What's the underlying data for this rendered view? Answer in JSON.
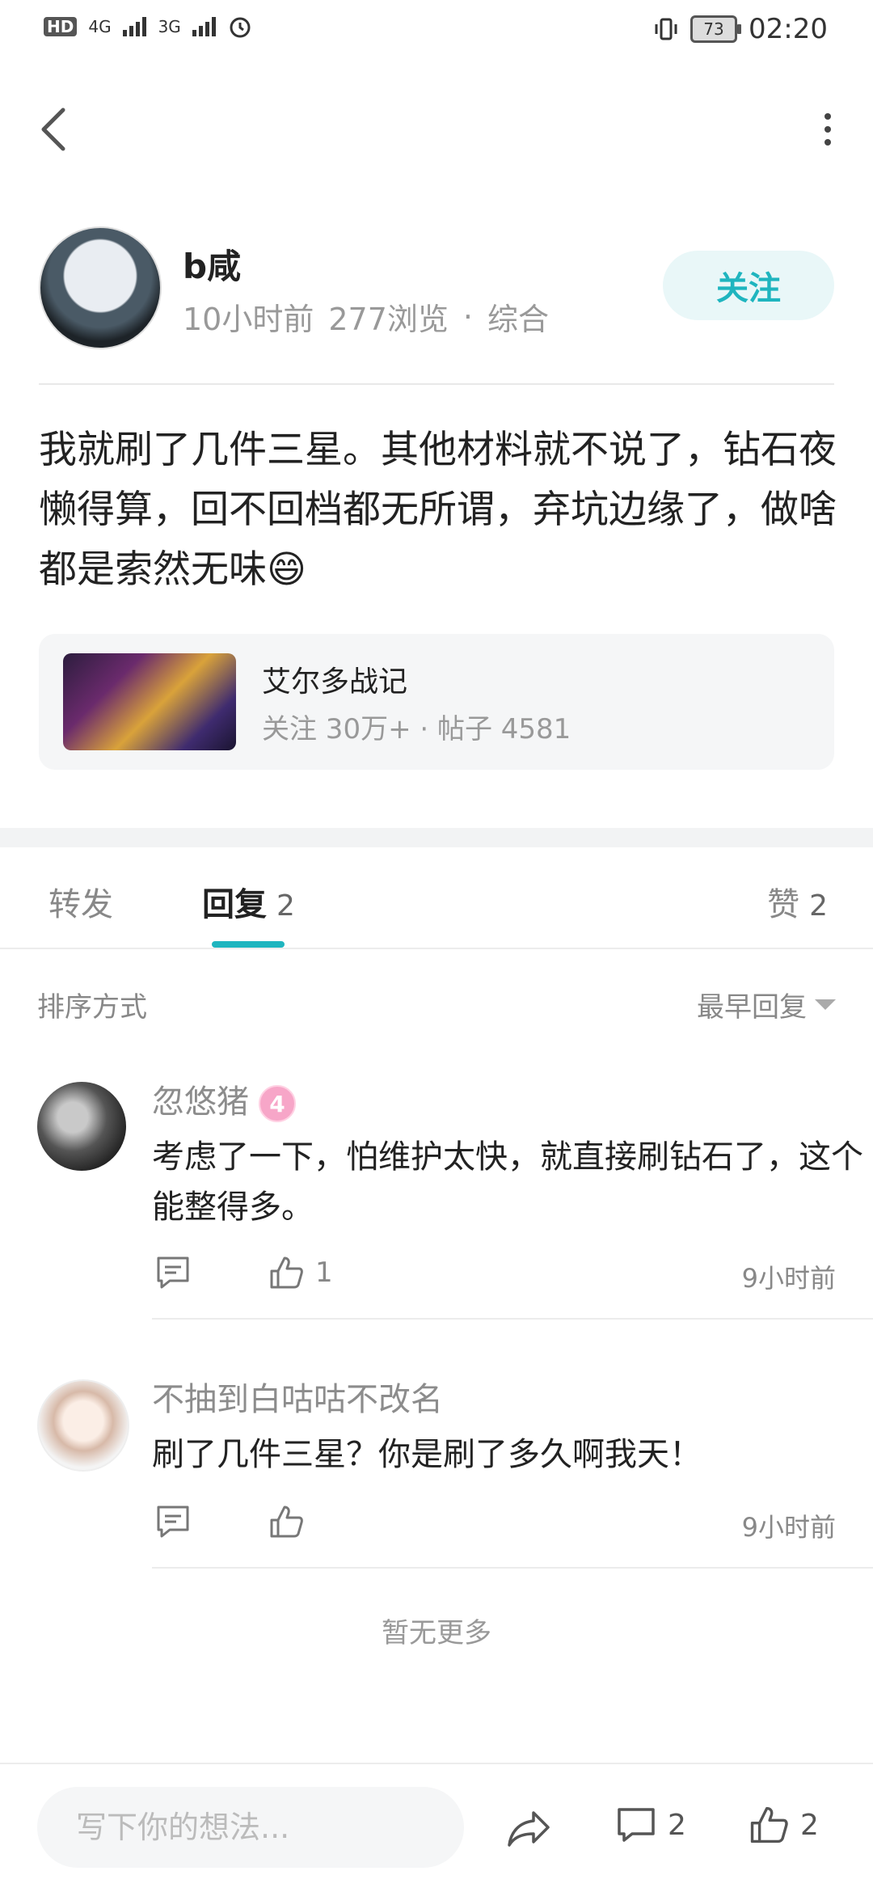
{
  "status_bar": {
    "left_indicators": [
      "HD",
      "4G",
      "3G"
    ],
    "battery": "73",
    "time": "02:20"
  },
  "author": {
    "name": "b咸",
    "time_ago": "10小时前",
    "views": "277浏览",
    "separator": "·",
    "category": "综合",
    "follow_label": "关注"
  },
  "post": {
    "text": "我就刷了几件三星。其他材料就不说了，钻石夜懒得算，回不回档都无所谓，弃坑边缘了，做啥都是索然无味😄"
  },
  "game_card": {
    "title": "艾尔多战记",
    "meta": "关注 30万+ · 帖子 4581"
  },
  "tabs": [
    {
      "label": "转发",
      "count": ""
    },
    {
      "label": "回复",
      "count": "2"
    },
    {
      "label": "赞",
      "count": "2"
    }
  ],
  "sort": {
    "label": "排序方式",
    "value": "最早回复"
  },
  "comments": [
    {
      "name": "忽悠猪",
      "level": "4",
      "text": "考虑了一下，怕维护太快，就直接刷钻石了，这个能整得多。",
      "likes": "1",
      "time": "9小时前"
    },
    {
      "name": "不抽到白咕咕不改名",
      "text": "刷了几件三星？你是刷了多久啊我天！",
      "likes": "",
      "time": "9小时前"
    }
  ],
  "no_more": "暂无更多",
  "bottom_bar": {
    "input_placeholder": "写下你的想法...",
    "comment_count": "2",
    "like_count": "2"
  },
  "colors": {
    "accent": "#1fb5bf",
    "follow_bg": "#e9f7f8",
    "level_badge": "#f7a6c8"
  }
}
